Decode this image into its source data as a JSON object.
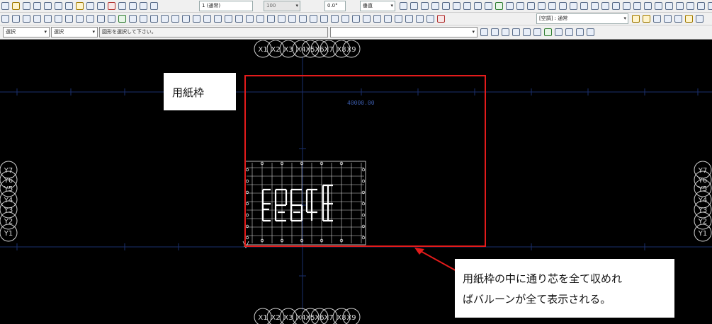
{
  "toolbar1": {
    "linetype_value": "1 (通常)",
    "pen_value": "100",
    "angle_value": "0.0°",
    "direction_value": "垂直"
  },
  "toolbar2": {
    "layer_value": "[空調] : 通常"
  },
  "toolbar3": {
    "mode1_value": "選択",
    "mode2_value": "選択",
    "status_message": "図形を選択して下さい。"
  },
  "drawing": {
    "x_grid_labels": [
      "X1",
      "X2",
      "X3",
      "X4",
      "X5",
      "X6",
      "X7",
      "X8",
      "X9"
    ],
    "y_grid_labels": [
      "Y7",
      "Y6",
      "Y5",
      "Y4",
      "Y3",
      "Y2",
      "Y1"
    ],
    "dimension_text": "40000.00"
  },
  "annotations": {
    "paper_frame_label": "用紙枠",
    "note_line1": "用紙枠の中に通り芯を全て収めれ",
    "note_line2": "ばバルーンが全て表示される。"
  },
  "colors": {
    "canvas_bg": "#000000",
    "grid_line": "#1a2f6e",
    "paper_frame": "#e31b1b",
    "balloon": "#cfcfcf",
    "drawing_lines": "#ffffff",
    "ground_line": "#7ed957"
  }
}
